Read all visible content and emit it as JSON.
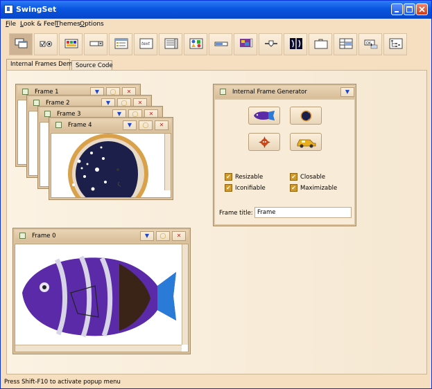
{
  "window": {
    "title": "SwingSet"
  },
  "menu": [
    {
      "label": "File",
      "underline": "F",
      "rest": "ile"
    },
    {
      "label": "Look & Feel",
      "underline": "L",
      "rest": "ook & Feel"
    },
    {
      "label": "Themes",
      "underline": "T",
      "rest": "hemes"
    },
    {
      "label": "Options",
      "underline": "O",
      "rest": "ptions"
    }
  ],
  "toolbar": {
    "icons": [
      "internal-frames-icon",
      "buttons-icon",
      "color-chooser-icon",
      "combobox-icon",
      "file-chooser-icon",
      "editor-pane-icon",
      "list-icon",
      "option-pane-icon",
      "progress-bar-icon",
      "scroll-pane-icon",
      "slider-icon",
      "split-pane-icon",
      "tabbed-pane-icon",
      "table-icon",
      "tooltip-icon",
      "tree-icon"
    ],
    "selected_index": 0
  },
  "tabs": [
    {
      "label": "Internal Frames Demo",
      "active": true
    },
    {
      "label": "Source Code",
      "active": false
    }
  ],
  "frames": [
    {
      "title": "Frame 1"
    },
    {
      "title": "Frame 2"
    },
    {
      "title": "Frame 3"
    },
    {
      "title": "Frame 4"
    },
    {
      "title": "Frame 0"
    }
  ],
  "generator": {
    "title": "Internal Frame Generator",
    "image_buttons": [
      "fish-icon",
      "moon-icon",
      "sun-icon",
      "cab-icon"
    ],
    "checkboxes": [
      {
        "label": "Resizable",
        "checked": true
      },
      {
        "label": "Closable",
        "checked": true
      },
      {
        "label": "Iconifiable",
        "checked": true
      },
      {
        "label": "Maximizable",
        "checked": true
      }
    ],
    "frame_title_label": "Frame title:",
    "frame_title_value": "Frame"
  },
  "status": "Press Shift-F10 to activate popup menu",
  "colors": {
    "titlebar": "#0a55e0",
    "background": "#f5dfc0",
    "frame_bar": "#d8bd98",
    "checkbox": "#d59a24"
  }
}
